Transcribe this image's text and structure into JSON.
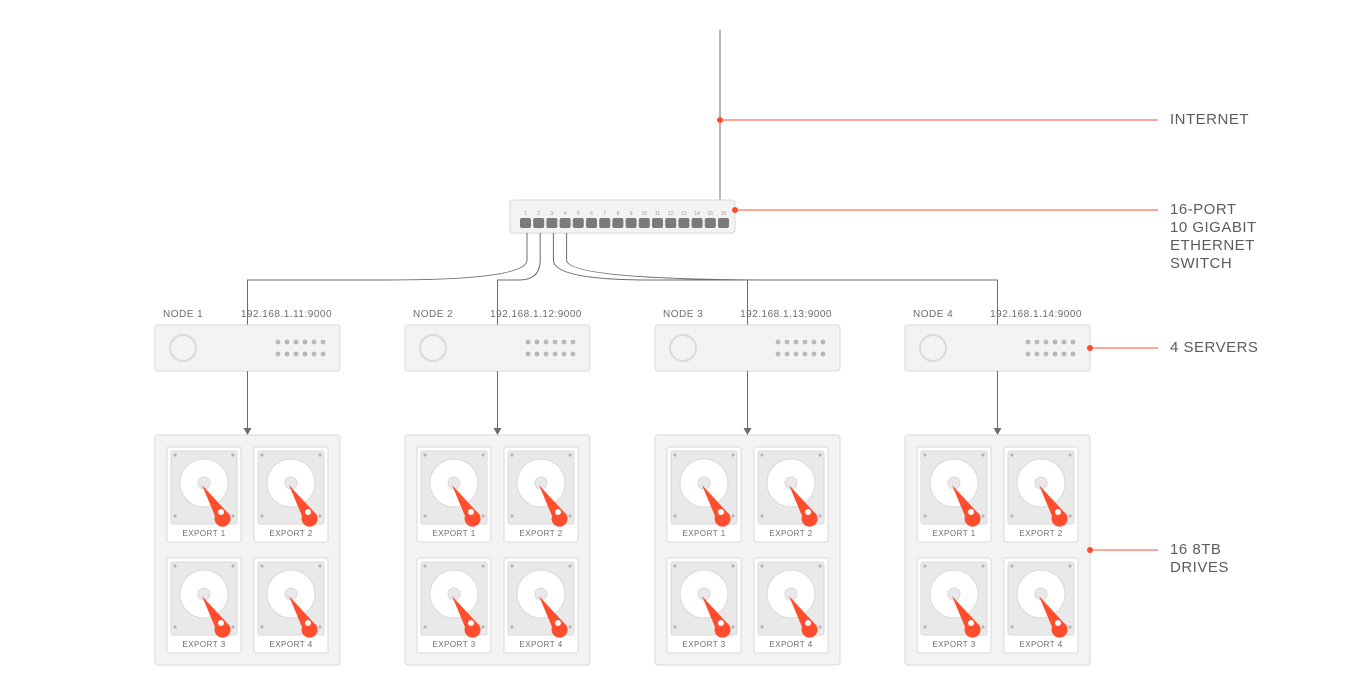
{
  "annotations": {
    "internet": "INTERNET",
    "switch_l1": "16-PORT",
    "switch_l2": "10 GIGABIT",
    "switch_l3": "ETHERNET",
    "switch_l4": "SWITCH",
    "servers": "4 SERVERS",
    "drives_l1": "16 8TB",
    "drives_l2": "DRIVES"
  },
  "switch": {
    "ports": 16
  },
  "nodes": [
    {
      "name": "NODE 1",
      "addr": "192.168.1.11:9000",
      "drives": [
        "EXPORT 1",
        "EXPORT 2",
        "EXPORT 3",
        "EXPORT 4"
      ]
    },
    {
      "name": "NODE 2",
      "addr": "192.168.1.12:9000",
      "drives": [
        "EXPORT 1",
        "EXPORT 2",
        "EXPORT 3",
        "EXPORT 4"
      ]
    },
    {
      "name": "NODE 3",
      "addr": "192.168.1.13:9000",
      "drives": [
        "EXPORT 1",
        "EXPORT 2",
        "EXPORT 3",
        "EXPORT 4"
      ]
    },
    {
      "name": "NODE 4",
      "addr": "192.168.1.14:9000",
      "drives": [
        "EXPORT 1",
        "EXPORT 2",
        "EXPORT 3",
        "EXPORT 4"
      ]
    }
  ],
  "colors": {
    "accent": "#ff4d2e",
    "panel": "#f3f3f3",
    "border": "#d9d9d9",
    "darkport": "#7a7a7a",
    "dotgray": "#b7b7b7",
    "disk": "#e9e9e9"
  }
}
